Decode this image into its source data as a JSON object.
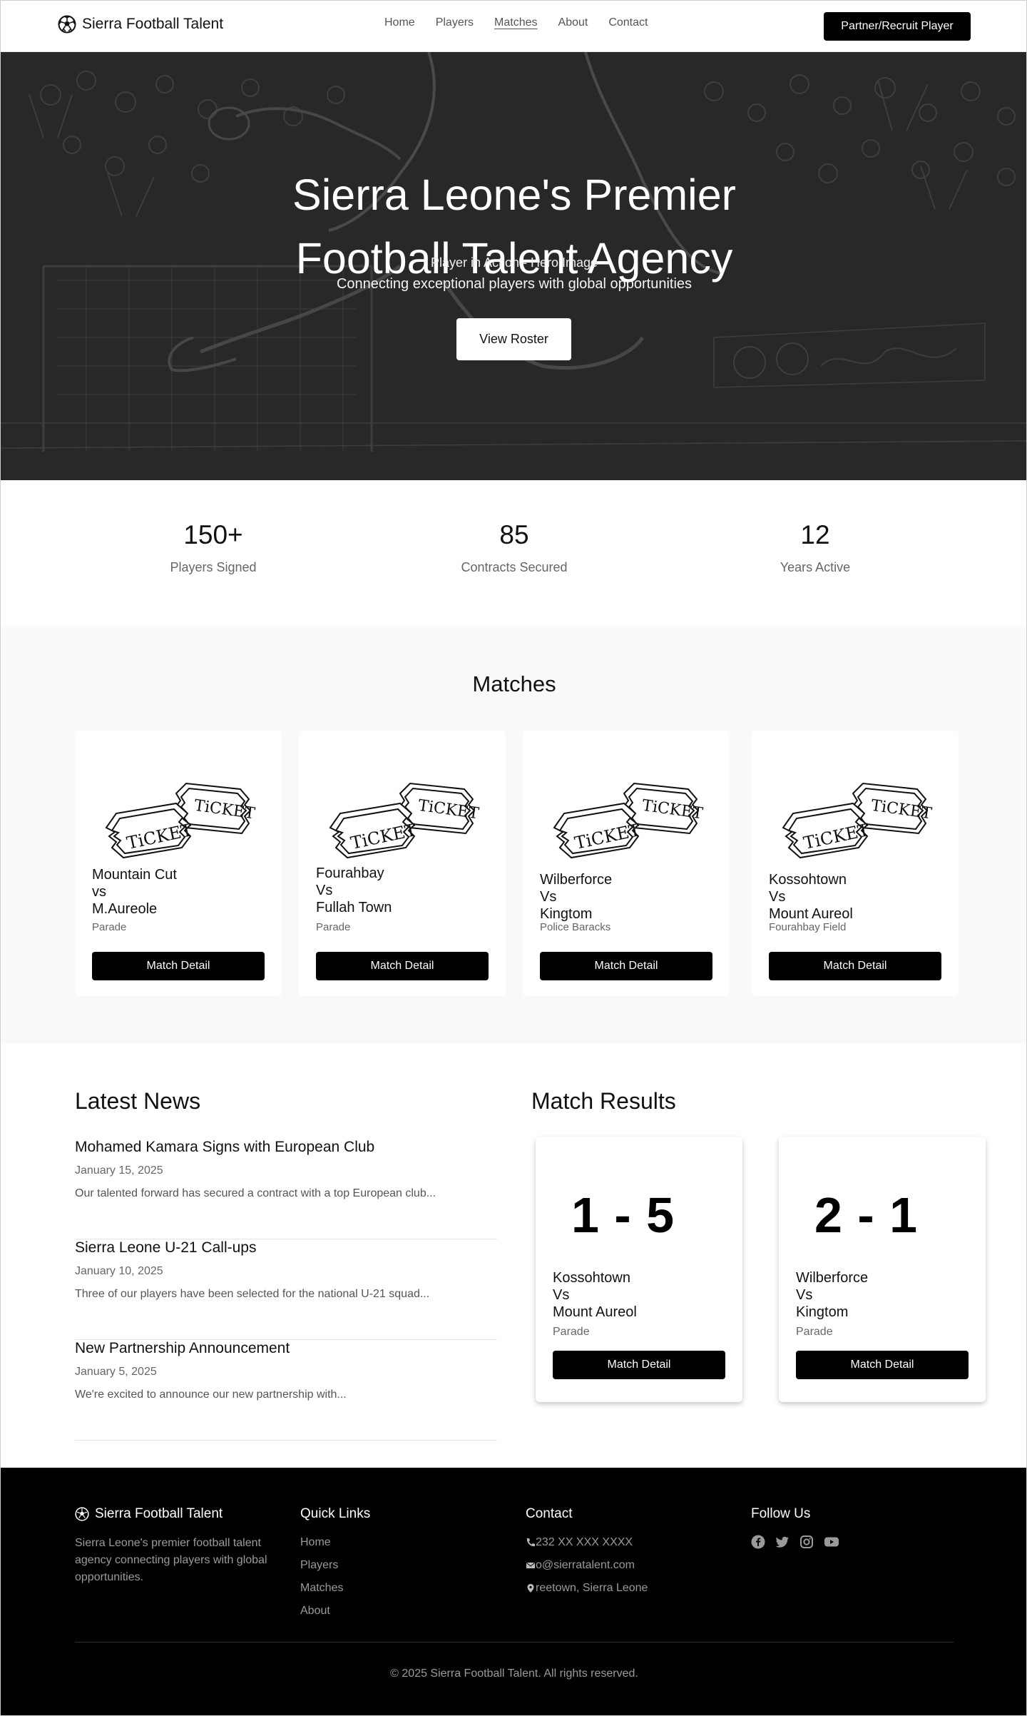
{
  "brand": {
    "name": "Sierra Football Talent",
    "icon": "soccer-ball-icon"
  },
  "nav": {
    "links": [
      "Home",
      "Players",
      "Matches",
      "About",
      "Contact"
    ],
    "active": "Matches",
    "cta": "Partner/Recruit Player"
  },
  "hero": {
    "title_line1": "Sierra Leone's Premier",
    "title_line2": "Football Talent Agency",
    "image_alt": "Player in Action - Hero Image",
    "subtitle": "Connecting exceptional players with global opportunities",
    "button": "View Roster"
  },
  "stats": [
    {
      "value": "150+",
      "label": "Players Signed"
    },
    {
      "value": "85",
      "label": "Contracts Secured"
    },
    {
      "value": "12",
      "label": "Years Active"
    }
  ],
  "matches": {
    "title": "Matches",
    "cards": [
      {
        "home": "Mountain Cut",
        "vs": "vs",
        "away": "M.Aureole",
        "venue": "Parade",
        "button": "Match Detail"
      },
      {
        "home": "Fourahbay",
        "vs": "Vs",
        "away": "Fullah Town",
        "venue": "Parade",
        "button": "Match Detail"
      },
      {
        "home": "Wilberforce",
        "vs": "Vs",
        "away": "Kingtom",
        "venue": "Police Baracks",
        "button": "Match Detail"
      },
      {
        "home": "Kossohtown",
        "vs": "Vs",
        "away": "Mount Aureol",
        "venue": "Fourahbay Field",
        "button": "Match Detail"
      }
    ]
  },
  "news": {
    "title": "Latest News",
    "items": [
      {
        "headline": "Mohamed Kamara Signs with European Club",
        "date": "January 15, 2025",
        "excerpt": "Our talented forward has secured a contract with a top European club..."
      },
      {
        "headline": "Sierra Leone U-21 Call-ups",
        "date": "January 10, 2025",
        "excerpt": "Three of our players have been selected for the national U-21 squad..."
      },
      {
        "headline": "New Partnership Announcement",
        "date": "January 5, 2025",
        "excerpt": "We're excited to announce our new partnership with..."
      }
    ]
  },
  "results": {
    "title": "Match Results",
    "cards": [
      {
        "score": "1 - 5",
        "home": "Kossohtown",
        "vs": "Vs",
        "away": "Mount Aureol",
        "venue": "Parade",
        "button": "Match Detail"
      },
      {
        "score": "2 - 1",
        "home": "Wilberforce",
        "vs": "Vs",
        "away": "Kingtom",
        "venue": "Parade",
        "button": "Match Detail"
      }
    ]
  },
  "footer": {
    "brand": "Sierra Football Talent",
    "about": "Sierra Leone's premier football talent agency connecting players with global opportunities.",
    "quick_links_title": "Quick Links",
    "quick_links": [
      "Home",
      "Players",
      "Matches",
      "About"
    ],
    "contact_title": "Contact",
    "phone": "232 XX XXX XXXX",
    "email": "o@sierratalent.com",
    "address": "reetown, Sierra Leone",
    "follow_title": "Follow Us",
    "social": [
      "facebook-icon",
      "twitter-icon",
      "instagram-icon",
      "youtube-icon"
    ],
    "copyright": "© 2025 Sierra Football Talent. All rights reserved."
  }
}
